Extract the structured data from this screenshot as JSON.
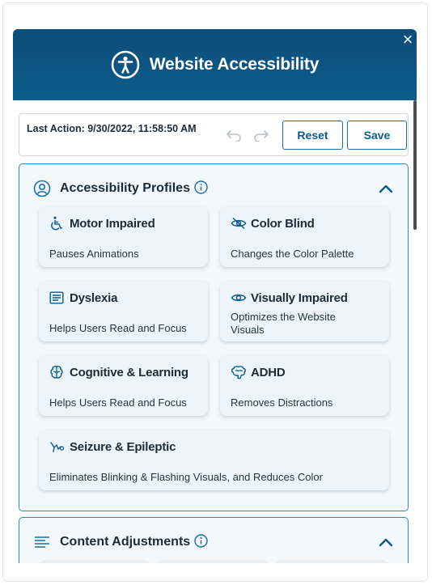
{
  "header": {
    "title": "Website Accessibility",
    "close_label": "×"
  },
  "action_bar": {
    "last_action": "Last Action: 9/30/2022, 11:58:50 AM",
    "reset_label": "Reset",
    "save_label": "Save"
  },
  "profiles": {
    "title": "Accessibility Profiles",
    "items": [
      {
        "title": "Motor Impaired",
        "desc": "Pauses Animations",
        "icon": "wheelchair-icon"
      },
      {
        "title": "Color Blind",
        "desc": "Changes the Color Palette",
        "icon": "eye-slash-icon"
      },
      {
        "title": "Dyslexia",
        "desc": "Helps Users Read and Focus",
        "icon": "reader-icon"
      },
      {
        "title": "Visually Impaired",
        "desc": "Optimizes the Website Visuals",
        "icon": "eye-icon"
      },
      {
        "title": "Cognitive & Learning",
        "desc": "Helps Users Read and Focus",
        "icon": "brain-icon"
      },
      {
        "title": "ADHD",
        "desc": "Removes Distractions",
        "icon": "brain-outline-icon"
      },
      {
        "title": "Seizure & Epileptic",
        "desc": "Eliminates Blinking & Flashing Visuals, and Reduces Color",
        "icon": "bolt-icon"
      }
    ]
  },
  "content_adjustments": {
    "title": "Content Adjustments"
  },
  "colors": {
    "header": "#0b5c8c",
    "accent": "#1a6ea5",
    "card_bg": "#edf5fa"
  }
}
